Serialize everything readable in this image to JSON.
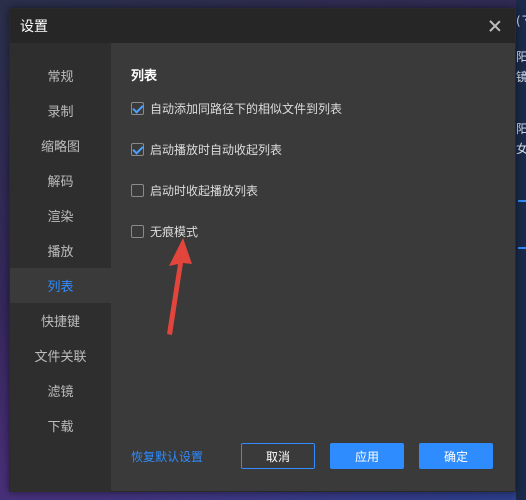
{
  "dialog": {
    "title": "设置"
  },
  "sidebar": {
    "items": [
      {
        "label": "常规"
      },
      {
        "label": "录制"
      },
      {
        "label": "缩略图"
      },
      {
        "label": "解码"
      },
      {
        "label": "渲染"
      },
      {
        "label": "播放"
      },
      {
        "label": "列表",
        "active": true
      },
      {
        "label": "快捷键"
      },
      {
        "label": "文件关联"
      },
      {
        "label": "滤镜"
      },
      {
        "label": "下载"
      }
    ]
  },
  "content": {
    "section_title": "列表",
    "options": [
      {
        "label": "自动添加同路径下的相似文件到列表",
        "checked": true
      },
      {
        "label": "启动播放时自动收起列表",
        "checked": true
      },
      {
        "label": "启动时收起播放列表",
        "checked": false
      },
      {
        "label": "无痕模式",
        "checked": false
      }
    ]
  },
  "footer": {
    "reset_label": "恢复默认设置",
    "cancel_label": "取消",
    "apply_label": "应用",
    "ok_label": "确定"
  },
  "background": {
    "edge_text": [
      "(ㄋ",
      "阳",
      "镜",
      "阳",
      "女"
    ]
  },
  "colors": {
    "accent": "#2f8cff",
    "arrow": "#e2453c",
    "dialog_bg": "#3a3a3a",
    "sidebar_bg": "#2e2e2e",
    "titlebar_bg": "#262626"
  }
}
